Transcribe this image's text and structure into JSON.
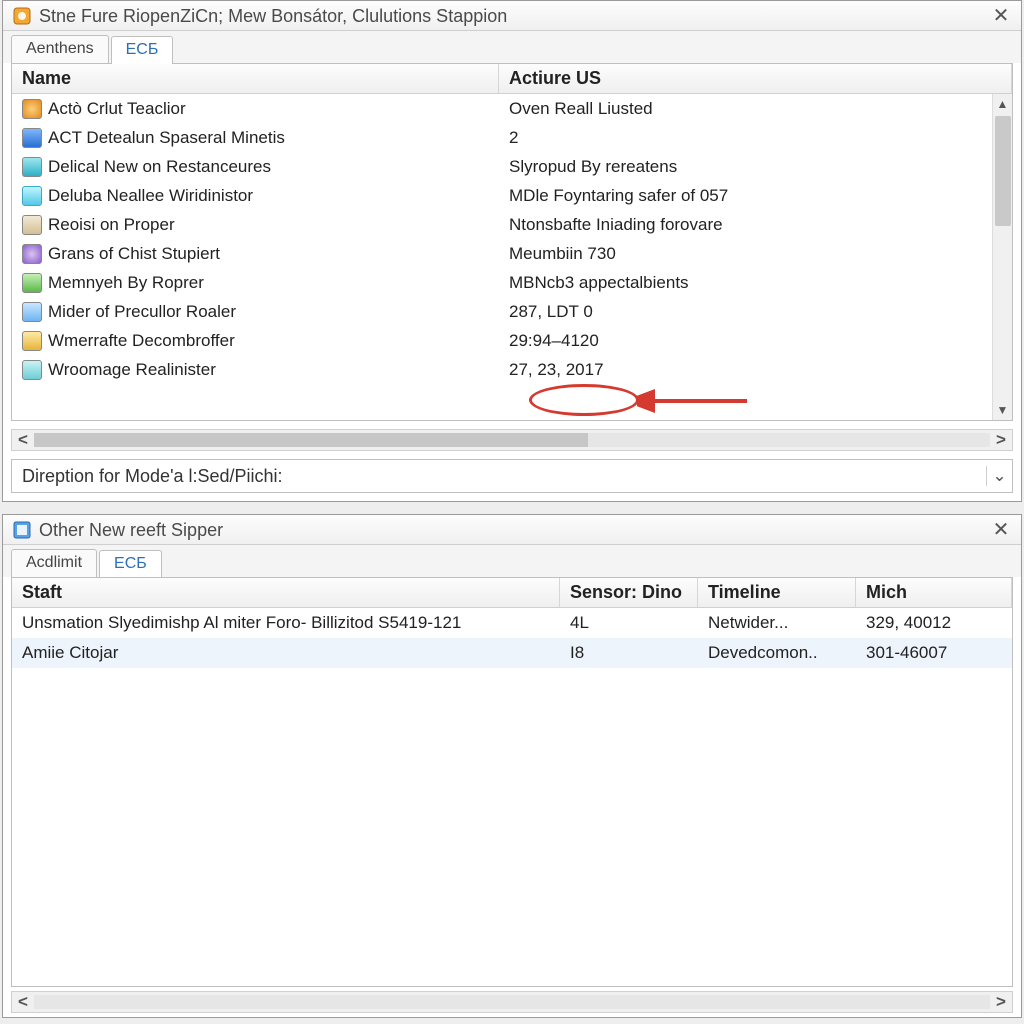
{
  "window1": {
    "title": "Stne Fure RiopenZiCn; Mew Bonsátor, Clulutions Stappion",
    "tabs": {
      "a": "Aenthens",
      "b": "ECБ"
    },
    "columns": {
      "name": "Name",
      "value": "Actiure US"
    },
    "rows": [
      {
        "icon": "ic-orange",
        "name": "Actò Crlut Teaclior",
        "value": "Oven Reall Liusted"
      },
      {
        "icon": "ic-blue",
        "name": "ACT Detealun Spaseral Minetis",
        "value": "2"
      },
      {
        "icon": "ic-teal",
        "name": "Delical New on Restanceures",
        "value": "Slyropud By rereatens"
      },
      {
        "icon": "ic-cyan",
        "name": "Deluba Neallee Wiridinistor",
        "value": "MDle Foyntaring safer of 057"
      },
      {
        "icon": "ic-tan",
        "name": "Reoisi on Proper",
        "value": "Ntonsbafte Iniading forovare"
      },
      {
        "icon": "ic-purple",
        "name": "Grans of Chist Stupiert",
        "value": "Meumbiin 730"
      },
      {
        "icon": "ic-green",
        "name": "Memnyeh By Roprer",
        "value": "MBNcb3 appectalbients"
      },
      {
        "icon": "ic-sky",
        "name": "Mider of Precullor Roaler",
        "value": "287, LDT 0"
      },
      {
        "icon": "ic-gold",
        "name": "Wmerrafte Decombroffer",
        "value": "29:94–4120"
      },
      {
        "icon": "ic-aqua",
        "name": "Wroomage Realinister",
        "value": "27, 23, 2017"
      }
    ],
    "description_label": "Direption for Mode'a l:Sed/Piichi:",
    "annotation_target_row": 9
  },
  "window2": {
    "title": "Other New reeft Sipper",
    "tabs": {
      "a": "Acdlimit",
      "b": "ECБ"
    },
    "columns": {
      "a": "Staft",
      "b": "Sensor: Dino",
      "c": "Timeline",
      "d": "Mich"
    },
    "rows": [
      {
        "a": "Unsmation Slyedimishp Al miter Foro- Billizitod S5419-121",
        "b": "4L",
        "c": "Netwider...",
        "d": "329, 40012"
      },
      {
        "a": "Amiie Citojar",
        "b": "I8",
        "c": "Devedcomon..",
        "d": "301-46007"
      }
    ]
  },
  "annotation": {
    "color": "#d43a2f"
  }
}
